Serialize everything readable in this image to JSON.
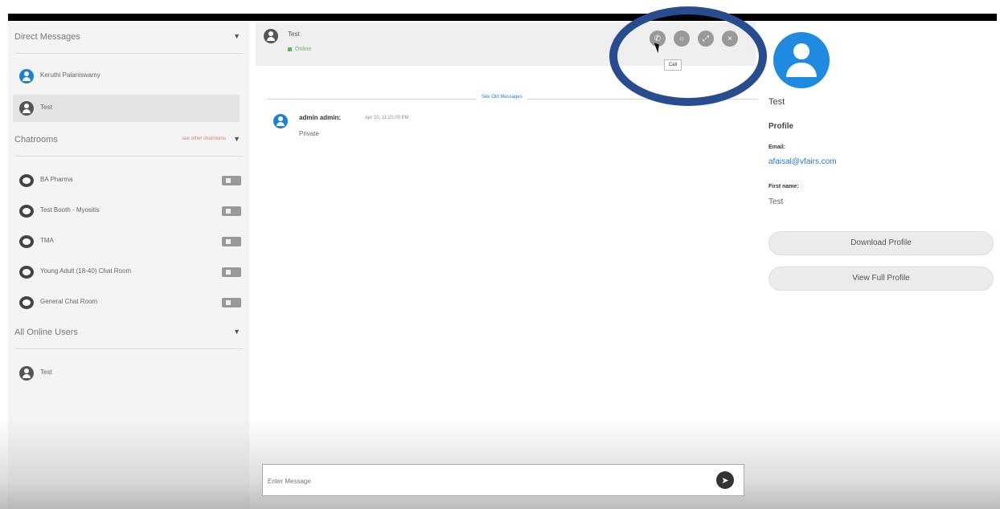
{
  "sidebar": {
    "direct_messages_label": "Direct Messages",
    "direct_messages": [
      {
        "name": "Keruthi Palaniswamy",
        "selected": false,
        "avatar_color": "#1a82d4"
      },
      {
        "name": "Test",
        "selected": true,
        "avatar_color": "#555555"
      }
    ],
    "chatrooms_label": "Chatrooms",
    "chatrooms_extra": "see other chatrooms",
    "chatrooms": [
      {
        "name": "BA Pharma"
      },
      {
        "name": "Test Booth - Myositis"
      },
      {
        "name": "TMA"
      },
      {
        "name": "Young Adult (18-40) Chat Room"
      },
      {
        "name": "General Chat Room"
      }
    ],
    "online_label": "All Online Users",
    "online_users": [
      {
        "name": "Test"
      }
    ]
  },
  "chat": {
    "title": "Test",
    "status": "Online",
    "status_color": "#5cb85c",
    "header_icons": [
      "phone-icon",
      "chat-bubble-icon",
      "expand-icon",
      "close-icon"
    ],
    "tooltip": "Call",
    "old_messages_link": "See Old Messages",
    "messages": [
      {
        "author": "admin admin:",
        "time": "Apr 20, 11:21:00 PM",
        "body": "Private"
      }
    ],
    "input_placeholder": "Enter Message"
  },
  "profile": {
    "name": "Test",
    "heading": "Profile",
    "email_label": "Email:",
    "email": "afaisal@vfairs.com",
    "first_name_label": "First name:",
    "first_name": "Test",
    "download_label": "Download Profile",
    "view_label": "View Full Profile",
    "avatar_color": "#1f8be0"
  },
  "highlight_color": "#274c8f"
}
